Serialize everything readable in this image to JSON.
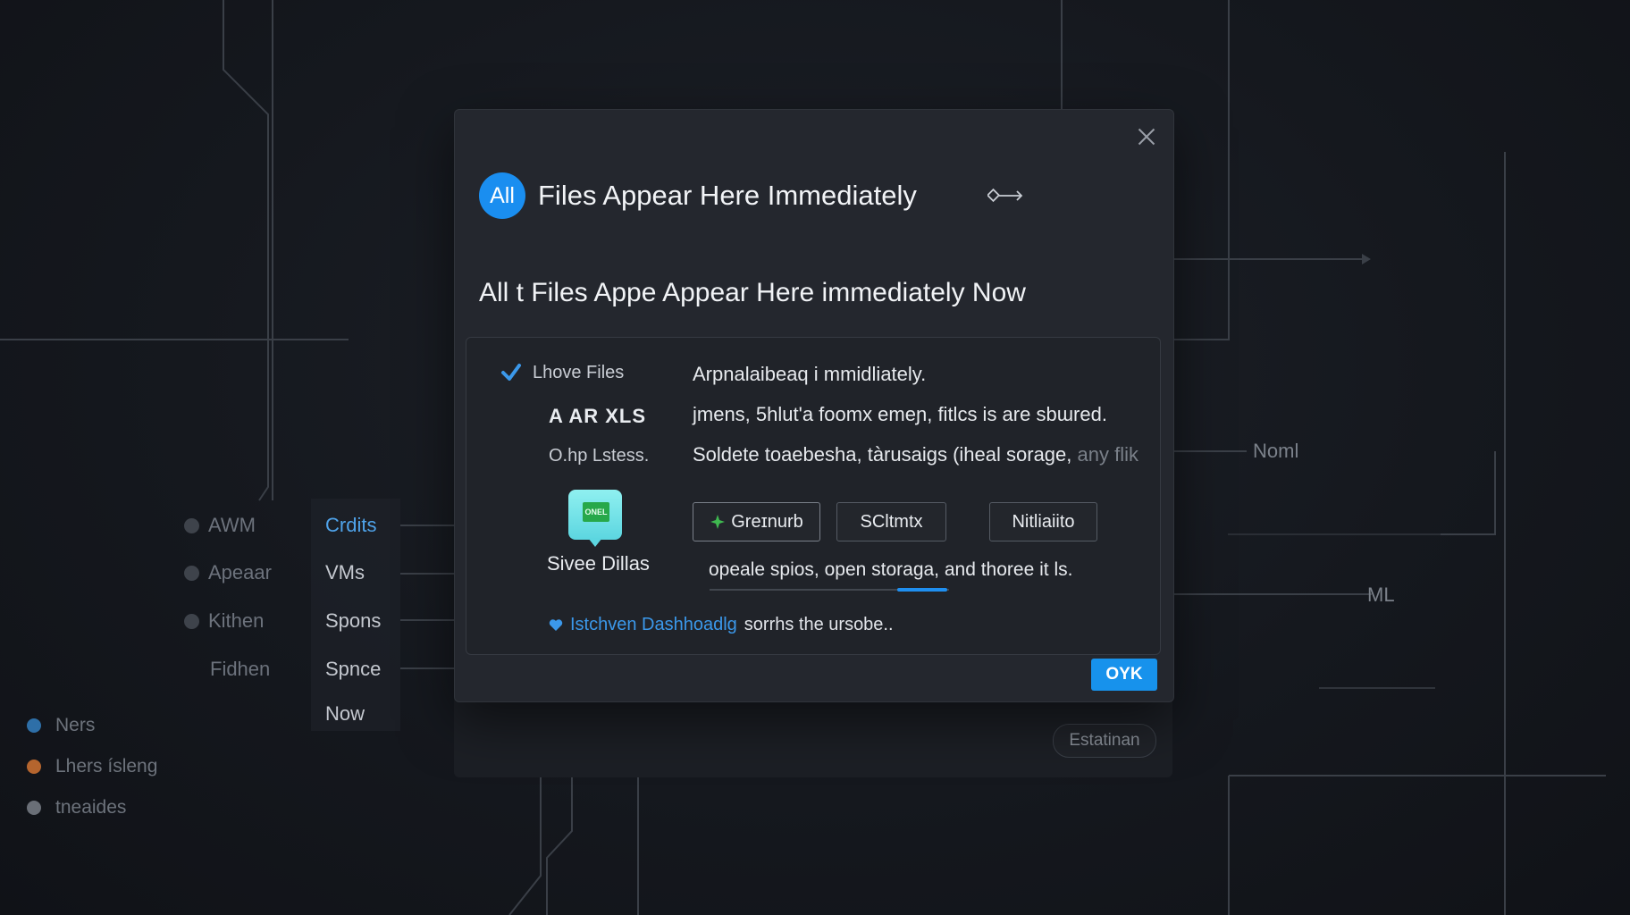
{
  "theme": {
    "accent": "#1a8ef0",
    "background": "#14171d",
    "dialog_bg": "#24272e",
    "legend_colors": [
      "#2e6fa8",
      "#b5652e",
      "#6a6f77"
    ]
  },
  "side_menu": {
    "items": [
      {
        "label": "AWM",
        "icon": "circle-icon"
      },
      {
        "label": "Apeaar",
        "icon": "circle-icon"
      },
      {
        "label": "Kithen",
        "icon": "circle-icon"
      },
      {
        "label": "Fidhen",
        "icon": ""
      }
    ]
  },
  "sub_menu": {
    "items": [
      {
        "label": "Crdits",
        "active": true
      },
      {
        "label": "VMs",
        "active": false
      },
      {
        "label": "Spons",
        "active": false
      },
      {
        "label": "Spnce",
        "active": false
      },
      {
        "label": "Now",
        "active": false
      }
    ]
  },
  "legend": {
    "items": [
      {
        "label": "Ners"
      },
      {
        "label": "Lhers ísleng"
      },
      {
        "label": "tneaides"
      }
    ]
  },
  "background_labels": {
    "noml": "Noml",
    "ml": "ML",
    "estatinan": "Estatinan"
  },
  "dialog": {
    "avatar_text": "All",
    "title": "Files Appear Here Immediately",
    "link_icon": "link-arrow-icon",
    "subtitle": "All t Files Appe Appear Here immediately Now",
    "panel": {
      "check_label": "Lhove Files",
      "code_label": "A AR XLS",
      "small_label": "O.hp Lstess.",
      "lines": {
        "l1": "Arpnalaibeaq i mmidliately.",
        "l2": "jmens, 5hlut'a foomx emeɲ, fitlcs is are sbɯred.",
        "l3_main": "Soldete toaebesha, tàrusaigs (iheal sorage,",
        "l3_fade": "any flik"
      },
      "app": {
        "tile_text": "ONEL",
        "label": "Sivee Dillas"
      },
      "buttons": {
        "b1": "Greɪnurb",
        "b2": "SCltmtx",
        "b3": "Nitliaiito"
      },
      "caption": "opeale spios, open storaga, and thoree it ls.",
      "footer": {
        "link": "Istchven Dashhoadlg",
        "text": "sorrhs the ursobe.."
      }
    },
    "ok_label": "OYK"
  }
}
